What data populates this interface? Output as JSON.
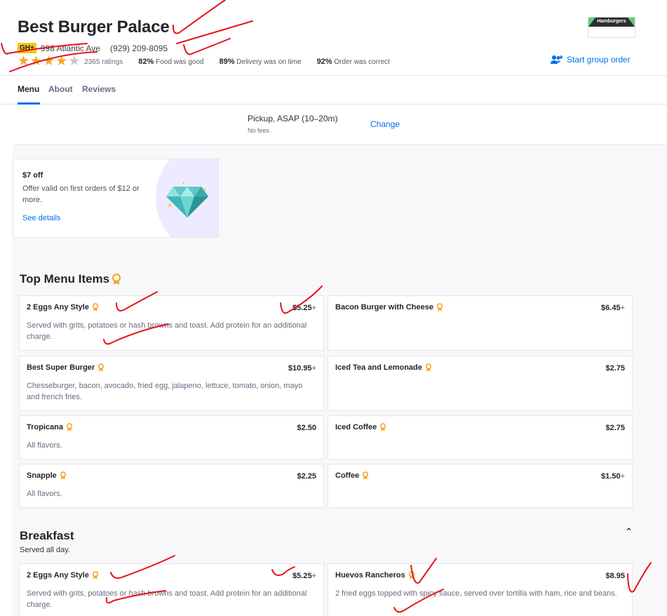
{
  "header": {
    "restaurant_name": "Best Burger Palace",
    "badge": "GH+",
    "address": "998 Atlantic Ave",
    "phone": "(929) 209-8095",
    "rating_stars": 4,
    "rating_count": "2365 ratings",
    "stats": [
      {
        "value": "82%",
        "label": "Food was good"
      },
      {
        "value": "89%",
        "label": "Delivery was on time"
      },
      {
        "value": "92%",
        "label": "Order was correct"
      }
    ],
    "logo_text": "Hamburgers",
    "group_order_label": "Start group order"
  },
  "tabs": [
    "Menu",
    "About",
    "Reviews"
  ],
  "pickup": {
    "mode": "Pickup, ASAP (10–20m)",
    "fees": "No fees",
    "change_label": "Change"
  },
  "offer": {
    "title": "$7 off",
    "description": "Offer valid on first orders of $12 or more.",
    "link": "See details"
  },
  "top_items": {
    "title": "Top Menu Items",
    "items": [
      {
        "name": "2 Eggs Any Style",
        "price": "$5.25",
        "plus": "+",
        "desc": "Served with grits, potatoes or hash browns and toast. Add protein for an additional charge."
      },
      {
        "name": "Bacon Burger with Cheese",
        "price": "$6.45",
        "plus": "+",
        "desc": ""
      },
      {
        "name": "Best Super Burger",
        "price": "$10.95",
        "plus": "+",
        "desc": "Chesseburger, bacon, avocado, fried egg, jalapeno, lettuce, tomato, onion, mayo and french fries."
      },
      {
        "name": "Iced Tea and Lemonade",
        "price": "$2.75",
        "plus": "",
        "desc": ""
      },
      {
        "name": "Tropicana",
        "price": "$2.50",
        "plus": "",
        "desc": "All flavors."
      },
      {
        "name": "Iced Coffee",
        "price": "$2.75",
        "plus": "",
        "desc": ""
      },
      {
        "name": "Snapple",
        "price": "$2.25",
        "plus": "",
        "desc": "All flavors."
      },
      {
        "name": "Coffee",
        "price": "$1.50",
        "plus": "+",
        "desc": ""
      }
    ]
  },
  "breakfast": {
    "title": "Breakfast",
    "subtitle": "Served all day.",
    "items": [
      {
        "name": "2 Eggs Any Style",
        "price": "$5.25",
        "plus": "+",
        "desc": "Served with grits, potatoes or hash browns and toast. Add protein for an additional charge."
      },
      {
        "name": "Huevos Rancheros",
        "price": "$8.95",
        "plus": "",
        "desc": "2 fried eggs topped with spicy sauce, served over tortilla with ham, rice and beans."
      }
    ]
  },
  "colors": {
    "accent": "#0070eb",
    "star": "#f5a623",
    "badge": "#f5c518",
    "ink": "#e3141b"
  },
  "icons": [
    "star-icon",
    "group-order-icon",
    "ribbon-icon",
    "diamond-icon",
    "chevron-up-icon"
  ]
}
